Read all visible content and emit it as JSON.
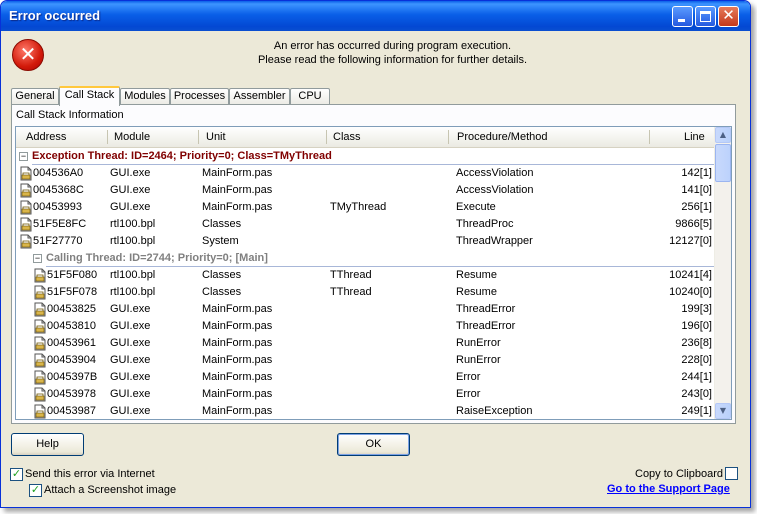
{
  "window": {
    "title": "Error occurred"
  },
  "message": {
    "line1": "An error has occurred during program execution.",
    "line2": "Please read the following information for further details."
  },
  "tabs": [
    {
      "label": "General",
      "active": false
    },
    {
      "label": "Call Stack",
      "active": true
    },
    {
      "label": "Modules",
      "active": false
    },
    {
      "label": "Processes",
      "active": false
    },
    {
      "label": "Assembler",
      "active": false
    },
    {
      "label": "CPU",
      "active": false
    }
  ],
  "panel": {
    "caption": "Call Stack Information"
  },
  "columns": [
    "Address",
    "Module",
    "Unit",
    "Class",
    "Procedure/Method",
    "Line"
  ],
  "groups": [
    {
      "label": "Exception Thread: ID=2464; Priority=0; Class=TMyThread",
      "color": "#800000",
      "rows": [
        {
          "address": "004536A0",
          "module": "GUI.exe",
          "unit": "MainForm.pas",
          "class": "",
          "procedure": "AccessViolation",
          "line": "142[1]"
        },
        {
          "address": "0045368C",
          "module": "GUI.exe",
          "unit": "MainForm.pas",
          "class": "",
          "procedure": "AccessViolation",
          "line": "141[0]"
        },
        {
          "address": "00453993",
          "module": "GUI.exe",
          "unit": "MainForm.pas",
          "class": "TMyThread",
          "procedure": "Execute",
          "line": "256[1]"
        },
        {
          "address": "51F5E8FC",
          "module": "rtl100.bpl",
          "unit": "Classes",
          "class": "",
          "procedure": "ThreadProc",
          "line": "9866[5]"
        },
        {
          "address": "51F27770",
          "module": "rtl100.bpl",
          "unit": "System",
          "class": "",
          "procedure": "ThreadWrapper",
          "line": "12127[0]"
        }
      ]
    },
    {
      "label": "Calling Thread: ID=2744; Priority=0; [Main]",
      "color": "#808080",
      "rows": [
        {
          "address": "51F5F080",
          "module": "rtl100.bpl",
          "unit": "Classes",
          "class": "TThread",
          "procedure": "Resume",
          "line": "10241[4]"
        },
        {
          "address": "51F5F078",
          "module": "rtl100.bpl",
          "unit": "Classes",
          "class": "TThread",
          "procedure": "Resume",
          "line": "10240[0]"
        },
        {
          "address": "00453825",
          "module": "GUI.exe",
          "unit": "MainForm.pas",
          "class": "",
          "procedure": "ThreadError",
          "line": "199[3]"
        },
        {
          "address": "00453810",
          "module": "GUI.exe",
          "unit": "MainForm.pas",
          "class": "",
          "procedure": "ThreadError",
          "line": "196[0]"
        },
        {
          "address": "00453961",
          "module": "GUI.exe",
          "unit": "MainForm.pas",
          "class": "",
          "procedure": "RunError",
          "line": "236[8]"
        },
        {
          "address": "00453904",
          "module": "GUI.exe",
          "unit": "MainForm.pas",
          "class": "",
          "procedure": "RunError",
          "line": "228[0]"
        },
        {
          "address": "0045397B",
          "module": "GUI.exe",
          "unit": "MainForm.pas",
          "class": "",
          "procedure": "Error",
          "line": "244[1]"
        },
        {
          "address": "00453978",
          "module": "GUI.exe",
          "unit": "MainForm.pas",
          "class": "",
          "procedure": "Error",
          "line": "243[0]"
        },
        {
          "address": "00453987",
          "module": "GUI.exe",
          "unit": "MainForm.pas",
          "class": "",
          "procedure": "RaiseException",
          "line": "249[1]"
        }
      ]
    }
  ],
  "buttons": {
    "help": "Help",
    "ok": "OK"
  },
  "options": {
    "send_internet": {
      "label": "Send this error via Internet",
      "checked": true
    },
    "attach_screenshot": {
      "label": "Attach a Screenshot image",
      "checked": true
    },
    "copy_clipboard": {
      "label": "Copy to Clipboard",
      "checked": false
    }
  },
  "support_link": "Go to the Support Page",
  "icons": {
    "error": "error-x-icon",
    "row": "stack-frame-icon",
    "minimize": "minimize-icon",
    "maximize": "maximize-icon",
    "close": "close-icon"
  }
}
